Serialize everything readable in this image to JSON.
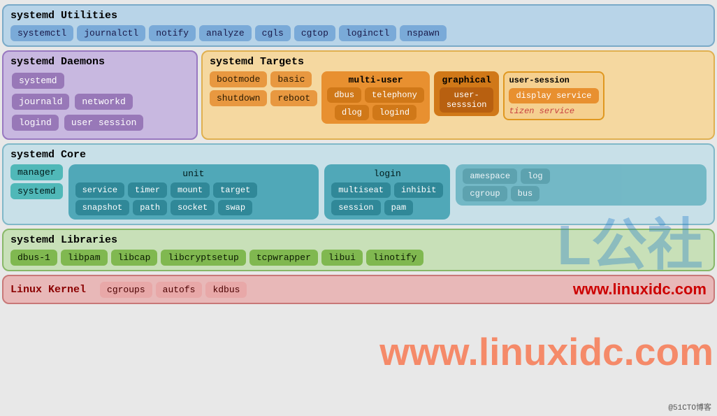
{
  "utilities": {
    "title": "systemd Utilities",
    "items": [
      "systemctl",
      "journalctl",
      "notify",
      "analyze",
      "cgls",
      "cgtop",
      "loginctl",
      "nspawn"
    ]
  },
  "daemons": {
    "title": "systemd Daemons",
    "items": [
      "systemd",
      "journald",
      "networkd",
      "logind",
      "user session"
    ]
  },
  "targets": {
    "title": "systemd Targets",
    "basic": [
      "bootmode",
      "basic",
      "shutdown",
      "reboot"
    ],
    "multiuser": {
      "label": "multi-user",
      "items": [
        "dbus",
        "telephony",
        "dlog",
        "logind"
      ]
    },
    "graphical": {
      "label": "graphical",
      "items": [
        "user-sesssion"
      ]
    },
    "userSession": {
      "label": "user-session",
      "displayService": "display service",
      "tizenService": "tizen service"
    }
  },
  "core": {
    "title": "systemd Core",
    "left": [
      "manager",
      "systemd"
    ],
    "unit": {
      "label": "unit",
      "row1": [
        "service",
        "timer",
        "mount",
        "target"
      ],
      "row2": [
        "snapshot",
        "path",
        "socket",
        "swap"
      ]
    },
    "login": {
      "label": "login",
      "row1": [
        "multiseat",
        "inhibit"
      ],
      "row2": [
        "session",
        "pam"
      ]
    },
    "namespace": {
      "label": "namespace",
      "items": [
        "log",
        "cgroup",
        "bus"
      ]
    }
  },
  "libraries": {
    "title": "systemd Libraries",
    "items": [
      "dbus-1",
      "libpam",
      "libcap",
      "libcryptsetup",
      "tcpwrapper",
      "libui",
      "linotify"
    ]
  },
  "kernel": {
    "title": "Linux Kernel",
    "items": [
      "cgroups",
      "autofs",
      "kdbus"
    ],
    "url": "www.linuxidc.com"
  },
  "watermark": {
    "text": "公社",
    "prefix": "L",
    "url": "www.linuxidc.com",
    "attribution": "@51CTO博客"
  }
}
